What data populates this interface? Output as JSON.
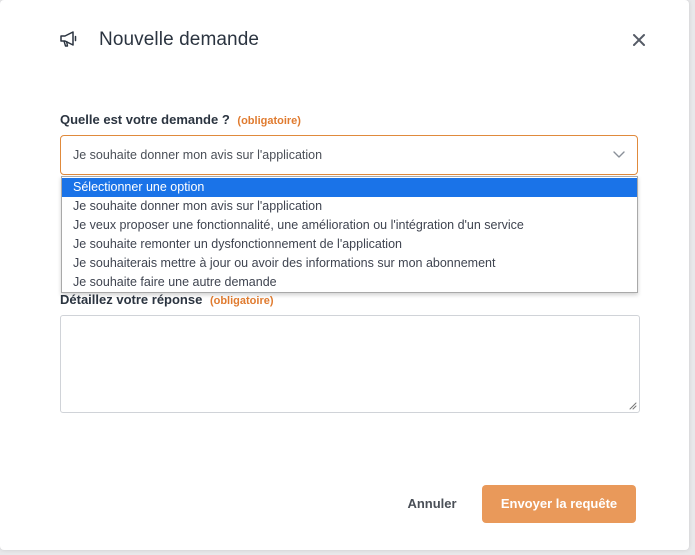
{
  "dialog": {
    "title": "Nouvelle demande",
    "header_icon": "megaphone-icon",
    "close_icon": "close-icon"
  },
  "request_field": {
    "label": "Quelle est votre demande ?",
    "required_tag": "(obligatoire)",
    "current_value": "Je souhaite donner mon avis sur l'application",
    "chevron_icon": "chevron-down-icon",
    "options": [
      "Sélectionner une option",
      "Je souhaite donner mon avis sur l'application",
      "Je veux proposer une fonctionnalité, une amélioration ou l'intégration d'un service",
      "Je souhaite remonter un dysfonctionnement de l'application",
      "Je souhaiterais mettre à jour ou avoir des informations sur mon abonnement",
      "Je souhaite faire une autre demande"
    ],
    "highlighted_option": "Sélectionner une option"
  },
  "detail_field": {
    "label": "Détaillez votre réponse",
    "required_tag": "(obligatoire)",
    "value": ""
  },
  "footer": {
    "cancel_label": "Annuler",
    "submit_label": "Envoyer la requête"
  },
  "colors": {
    "accent": "#e07b2f",
    "submit_bg": "#e9995a",
    "option_highlight": "#1a73e8",
    "text_dark": "#2b3440"
  }
}
